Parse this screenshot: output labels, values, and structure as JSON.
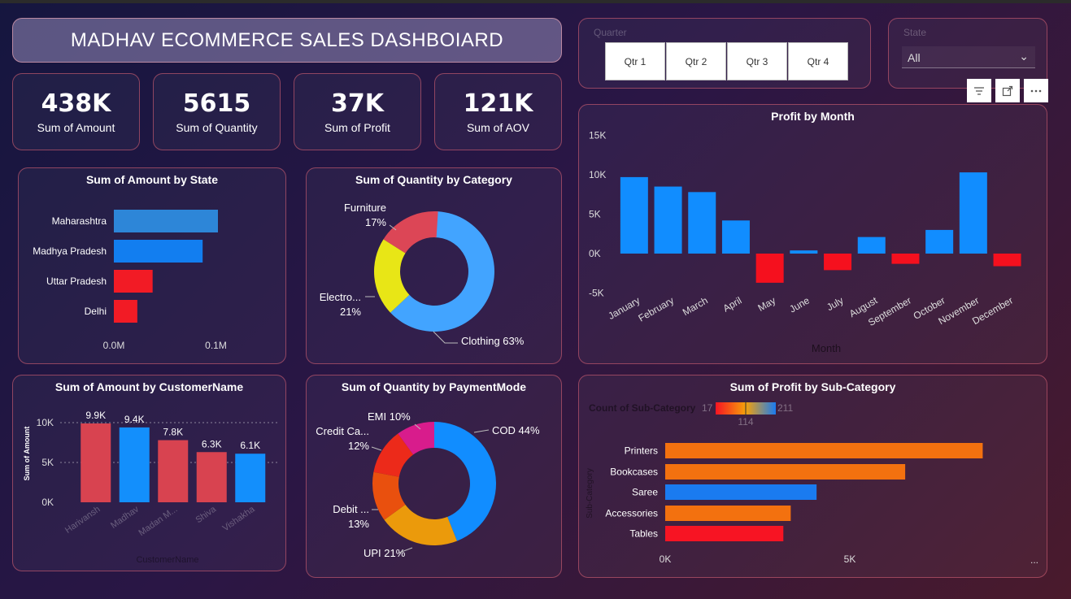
{
  "header": {
    "title": "MADHAV ECOMMERCE SALES DASHBOIARD"
  },
  "kpis": [
    {
      "value": "438K",
      "label": "Sum of Amount"
    },
    {
      "value": "5615",
      "label": "Sum of Quantity"
    },
    {
      "value": "37K",
      "label": "Sum of Profit"
    },
    {
      "value": "121K",
      "label": "Sum of AOV"
    }
  ],
  "quarter_slicer": {
    "label": "Quarter",
    "options": [
      "Qtr 1",
      "Qtr 2",
      "Qtr 3",
      "Qtr 4"
    ]
  },
  "state_slicer": {
    "label": "State",
    "selected": "All"
  },
  "visual_header_icons": [
    "filter-icon",
    "focus-mode-icon",
    "more-options-icon"
  ],
  "chart_data": [
    {
      "id": "profit_by_month",
      "type": "bar",
      "title": "Profit by Month",
      "xlabel": "Month",
      "ylabel": "",
      "categories": [
        "January",
        "February",
        "March",
        "April",
        "May",
        "June",
        "July",
        "August",
        "September",
        "October",
        "November",
        "December"
      ],
      "values": [
        9700,
        8500,
        7800,
        4200,
        -3700,
        400,
        -2100,
        2100,
        -1300,
        3000,
        10300,
        -1600
      ],
      "ylim": [
        -5000,
        15000
      ],
      "yticks": [
        "-5K",
        "0K",
        "5K",
        "10K",
        "15K"
      ],
      "colors": {
        "positive": "#118dff",
        "negative": "#f5101e"
      }
    },
    {
      "id": "amount_by_state",
      "type": "bar",
      "orientation": "horizontal",
      "title": "Sum of Amount by State",
      "categories": [
        "Maharashtra",
        "Madhya Pradesh",
        "Uttar Pradesh",
        "Delhi"
      ],
      "values": [
        102000,
        87000,
        38000,
        23000
      ],
      "xlim": [
        0,
        100000
      ],
      "xticks": [
        "0.0M",
        "0.1M"
      ],
      "colors": [
        "#2d86d8",
        "#127ef0",
        "#f21b25",
        "#f21b25"
      ]
    },
    {
      "id": "quantity_by_category",
      "type": "pie",
      "style": "donut",
      "title": "Sum of Quantity by Category",
      "slices": [
        {
          "label": "Clothing",
          "pct": 63,
          "display": "Clothing 63%",
          "color": "#42a4ff"
        },
        {
          "label": "Electro...",
          "pct": 21,
          "display": "Electro...|21%",
          "color": "#e8e616"
        },
        {
          "label": "Furniture",
          "pct": 17,
          "display": "Furniture|17%",
          "color": "#dc4656"
        }
      ]
    },
    {
      "id": "amount_by_customer",
      "type": "bar",
      "title": "Sum of Amount by CustomerName",
      "ylabel": "Sum of Amount",
      "xlabel": "CustomerName",
      "categories": [
        "Harivansh",
        "Madhav",
        "Madan M...",
        "Shiva",
        "Vishakha"
      ],
      "values": [
        9900,
        9400,
        7800,
        6300,
        6100
      ],
      "data_labels": [
        "9.9K",
        "9.4K",
        "7.8K",
        "6.3K",
        "6.1K"
      ],
      "ylim": [
        0,
        10000
      ],
      "yticks": [
        "0K",
        "5K",
        "10K"
      ],
      "colors": [
        "#d84350",
        "#138ffc",
        "#d84350",
        "#d84350",
        "#138ffc"
      ]
    },
    {
      "id": "quantity_by_paymentmode",
      "type": "pie",
      "style": "donut",
      "title": "Sum of Quantity by PaymentMode",
      "slices": [
        {
          "label": "COD",
          "pct": 44,
          "display": "COD 44%",
          "color": "#118dff"
        },
        {
          "label": "UPI",
          "pct": 21,
          "display": "UPI 21%",
          "color": "#eb9a0b"
        },
        {
          "label": "Debit ...",
          "pct": 13,
          "display": "Debit ...|13%",
          "color": "#e9500e"
        },
        {
          "label": "Credit Ca...",
          "pct": 12,
          "display": "Credit Ca...|12%",
          "color": "#ec2a1a"
        },
        {
          "label": "EMI",
          "pct": 10,
          "display": "EMI 10%",
          "color": "#d81c8c"
        }
      ]
    },
    {
      "id": "profit_by_subcategory",
      "type": "bar",
      "orientation": "horizontal",
      "title": "Sum of Profit by Sub-Category",
      "ylabel": "Sub-Category",
      "categories": [
        "Printers",
        "Bookcases",
        "Saree",
        "Accessories",
        "Tables"
      ],
      "values": [
        8600,
        6500,
        4100,
        3400,
        3200
      ],
      "xlim": [
        0,
        10000
      ],
      "xticks": [
        "0K",
        "5K"
      ],
      "colors": [
        "#f3710f",
        "#f3710f",
        "#1a7bf0",
        "#f3710f",
        "#f71423"
      ],
      "color_legend": {
        "title": "Count of Sub-Category",
        "min": "17",
        "mid": "114",
        "max": "211"
      }
    }
  ]
}
